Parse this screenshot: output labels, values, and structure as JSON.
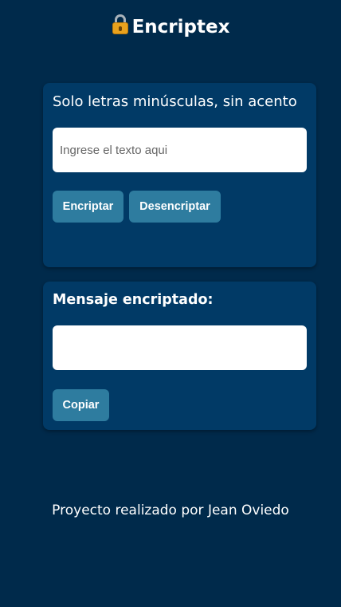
{
  "header": {
    "icon": "lock-icon",
    "title": "Encriptex"
  },
  "input_card": {
    "title": "Solo letras minúsculas, sin acento",
    "text_input": {
      "placeholder": "Ingrese el texto aqui",
      "value": ""
    },
    "encrypt_label": "Encriptar",
    "decrypt_label": "Desencriptar"
  },
  "output_card": {
    "title": "Mensaje encriptado:",
    "output_value": "",
    "copy_label": "Copiar"
  },
  "footer": {
    "credit": "Proyecto realizado por Jean Oviedo"
  },
  "colors": {
    "background": "#002a4b",
    "card": "#013a66",
    "button": "#2e7c9f",
    "text": "#ffffff"
  }
}
